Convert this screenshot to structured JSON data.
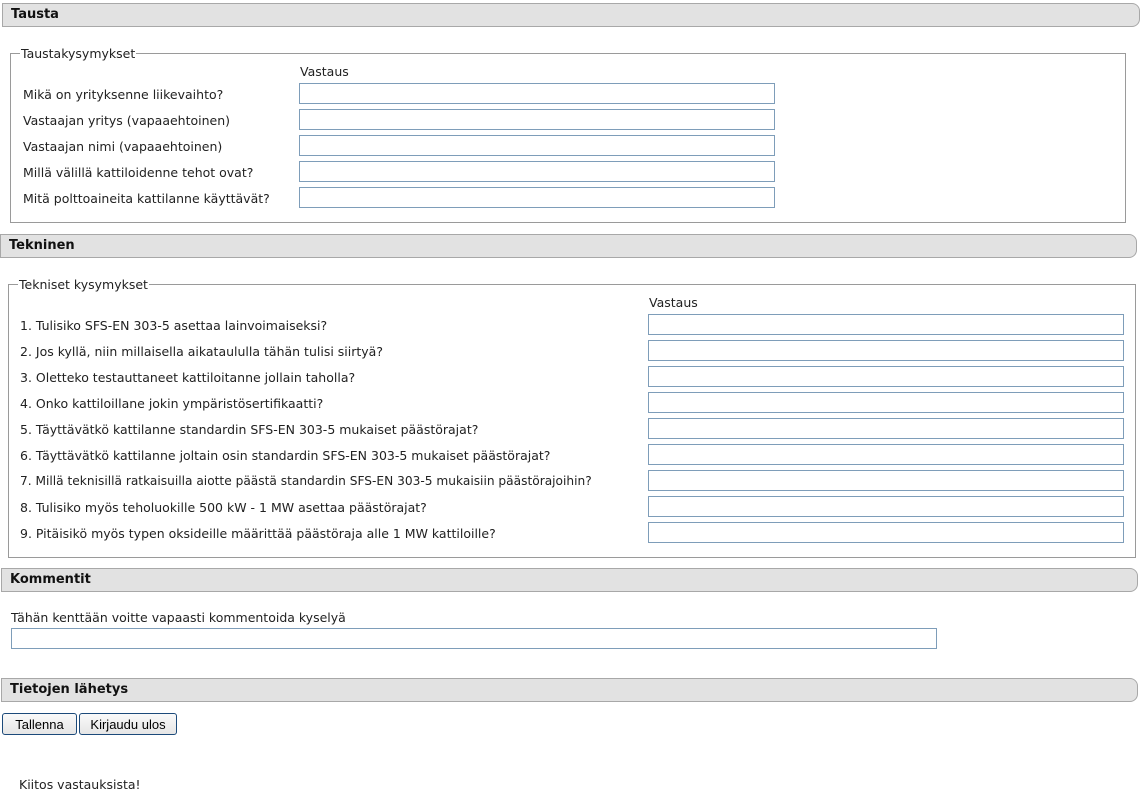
{
  "tausta": {
    "title": "Tausta",
    "legend": "Taustakysymykset",
    "answer_header": "Vastaus",
    "questions": [
      {
        "label": "Mikä on yrityksenne liikevaihto?",
        "value": ""
      },
      {
        "label": "Vastaajan yritys (vapaaehtoinen)",
        "value": ""
      },
      {
        "label": "Vastaajan nimi (vapaaehtoinen)",
        "value": ""
      },
      {
        "label": "Millä välillä kattiloidenne tehot ovat?",
        "value": ""
      },
      {
        "label": "Mitä polttoaineita kattilanne käyttävät?",
        "value": ""
      }
    ]
  },
  "tekninen": {
    "title": "Tekninen",
    "legend": "Tekniset kysymykset",
    "answer_header": "Vastaus",
    "questions": [
      {
        "label": "1. Tulisiko SFS-EN 303-5 asettaa lainvoimaiseksi?",
        "value": ""
      },
      {
        "label": "2. Jos kyllä, niin millaisella aikataululla tähän tulisi siirtyä?",
        "value": ""
      },
      {
        "label": "3. Oletteko testauttaneet kattiloitanne jollain taholla?",
        "value": ""
      },
      {
        "label": "4. Onko kattiloillane jokin ympäristösertifikaatti?",
        "value": ""
      },
      {
        "label": "5. Täyttävätkö kattilanne standardin SFS-EN 303-5 mukaiset päästörajat?",
        "value": ""
      },
      {
        "label": "6. Täyttävätkö kattilanne joltain osin standardin SFS-EN 303-5 mukaiset päästörajat?",
        "value": ""
      },
      {
        "label": "7. Millä teknisillä ratkaisuilla aiotte päästä standardin SFS-EN 303-5 mukaisiin päästörajoihin?",
        "value": ""
      },
      {
        "label": "8. Tulisiko myös teholuokille 500 kW - 1 MW asettaa päästörajat?",
        "value": ""
      },
      {
        "label": "9. Pitäisikö myös typen oksideille määrittää päästöraja alle 1 MW kattiloille?",
        "value": ""
      }
    ]
  },
  "kommentit": {
    "title": "Kommentit",
    "label": "Tähän kenttään voitte vapaasti kommentoida kyselyä",
    "value": ""
  },
  "lahetys": {
    "title": "Tietojen lähetys",
    "save_label": "Tallenna",
    "logout_label": "Kirjaudu ulos"
  },
  "thanks": "Kiitos vastauksista!"
}
